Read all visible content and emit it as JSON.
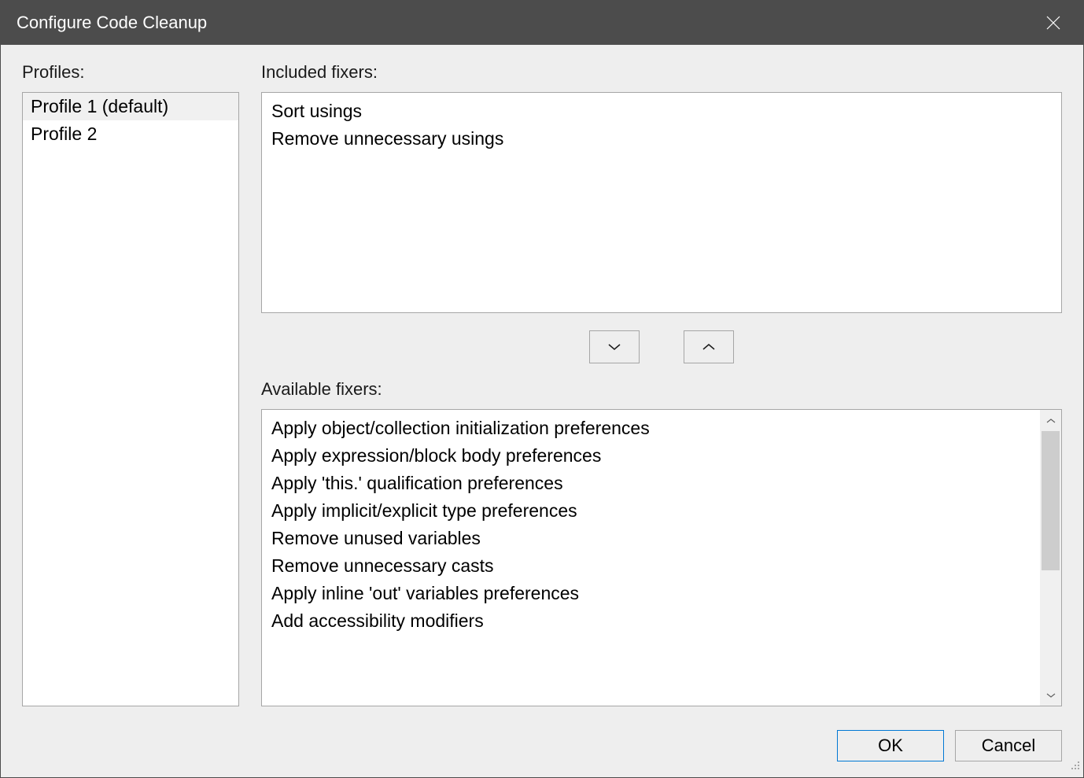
{
  "titlebar": {
    "title": "Configure Code Cleanup"
  },
  "profiles": {
    "label": "Profiles:",
    "items": [
      {
        "label": "Profile 1 (default)",
        "selected": true
      },
      {
        "label": "Profile 2",
        "selected": false
      }
    ]
  },
  "included": {
    "label": "Included fixers:",
    "items": [
      "Sort usings",
      "Remove unnecessary usings"
    ]
  },
  "available": {
    "label": "Available fixers:",
    "items": [
      "Apply object/collection initialization preferences",
      "Apply expression/block body preferences",
      "Apply 'this.' qualification preferences",
      "Apply implicit/explicit type preferences",
      "Remove unused variables",
      "Remove unnecessary casts",
      "Apply inline 'out' variables preferences",
      "Add accessibility modifiers"
    ]
  },
  "buttons": {
    "ok": "OK",
    "cancel": "Cancel"
  }
}
